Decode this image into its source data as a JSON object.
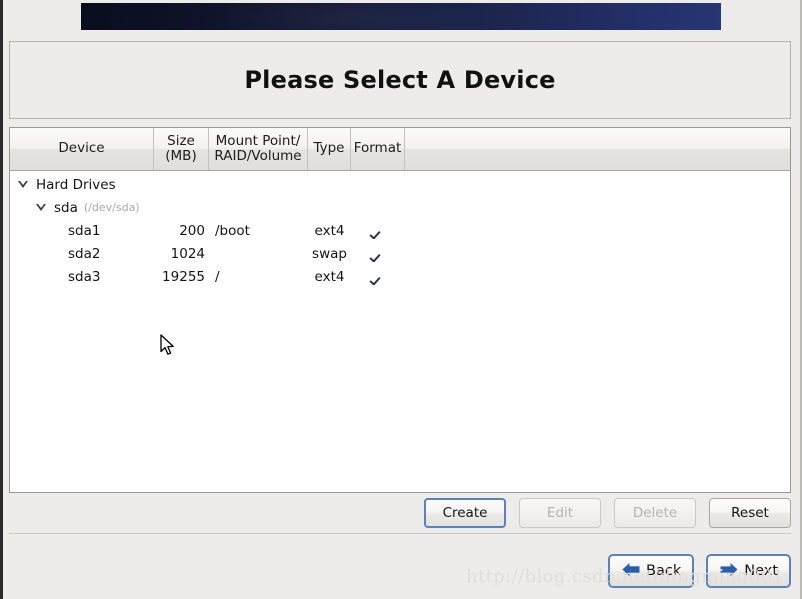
{
  "window": {
    "banner_gradient_from": "#0a0d1d",
    "banner_gradient_to": "#273674"
  },
  "title": {
    "text": "Please Select A Device"
  },
  "device_table": {
    "columns": [
      {
        "key": "device",
        "label": "Device"
      },
      {
        "key": "size",
        "label_line1": "Size",
        "label_line2": "(MB)"
      },
      {
        "key": "mount",
        "label_line1": "Mount Point/",
        "label_line2": "RAID/Volume"
      },
      {
        "key": "type",
        "label": "Type"
      },
      {
        "key": "format",
        "label": "Format"
      }
    ],
    "rows": [
      {
        "kind": "group",
        "device": "Hard Drives",
        "expanded": true,
        "size": "",
        "mount": "",
        "type": "",
        "format": false
      },
      {
        "kind": "drive",
        "device": "sda",
        "device_path": "(/dev/sda)",
        "expanded": true,
        "size": "",
        "mount": "",
        "type": "",
        "format": false
      },
      {
        "kind": "partition",
        "device": "sda1",
        "size": "200",
        "mount": "/boot",
        "type": "ext4",
        "format": true
      },
      {
        "kind": "partition",
        "device": "sda2",
        "size": "1024",
        "mount": "",
        "type": "swap",
        "format": true
      },
      {
        "kind": "partition",
        "device": "sda3",
        "size": "19255",
        "mount": "/",
        "type": "ext4",
        "format": true
      }
    ]
  },
  "actions": {
    "create": {
      "label": "Create",
      "enabled": true,
      "focused": true
    },
    "edit": {
      "label": "Edit",
      "enabled": false,
      "focused": false
    },
    "delete": {
      "label": "Delete",
      "enabled": false,
      "focused": false
    },
    "reset": {
      "label": "Reset",
      "enabled": true,
      "focused": false
    }
  },
  "navigation": {
    "back": {
      "label": "Back",
      "icon": "arrow-left-icon"
    },
    "next": {
      "label": "Next",
      "icon": "arrow-right-icon"
    }
  },
  "watermark": {
    "text": "http://blog.csdn.net/dingming001"
  },
  "colors": {
    "accent_blue": "#2b5fa8",
    "focus_border": "#5b81b8",
    "check_mark": "#2b3350",
    "window_bg": "#edecea",
    "list_bg": "#ffffff"
  }
}
